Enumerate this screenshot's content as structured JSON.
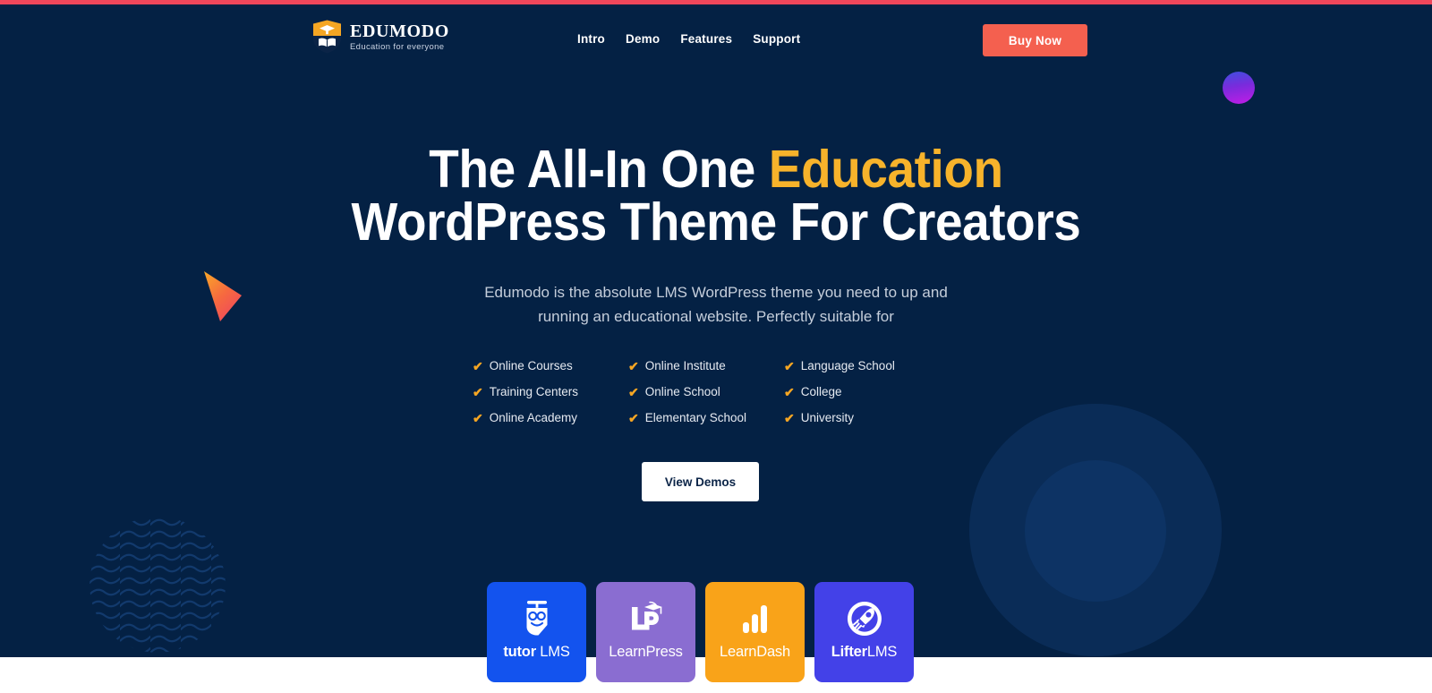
{
  "theme": {
    "bg_navy": "#042144",
    "accent_yellow": "#f7b32b",
    "accent_coral": "#f4604f",
    "accent_red_bar": "#f0475b",
    "check_orange": "#f5a623"
  },
  "header": {
    "logo": {
      "icon": "graduation-cap-shield-icon",
      "word": "EDUMODO",
      "tagline": "Education for everyone"
    },
    "nav": [
      {
        "label": "Intro"
      },
      {
        "label": "Demo"
      },
      {
        "label": "Features"
      },
      {
        "label": "Support"
      }
    ],
    "cta": {
      "label": "Buy Now"
    }
  },
  "hero": {
    "title_line1_a": "The All-In One ",
    "title_line1_accent": "Education",
    "title_line2": "WordPress Theme For Creators",
    "subtitle_line1": "Edumodo is the absolute LMS WordPress theme you need to up and",
    "subtitle_line2": "running an educational website. Perfectly suitable for",
    "features": [
      {
        "label": "Online Courses"
      },
      {
        "label": "Online Institute"
      },
      {
        "label": "Language School"
      },
      {
        "label": "Training Centers"
      },
      {
        "label": "Online School"
      },
      {
        "label": "College"
      },
      {
        "label": "Online Academy"
      },
      {
        "label": "Elementary School"
      },
      {
        "label": "University"
      }
    ],
    "demos_button": {
      "label": "View Demos"
    }
  },
  "plugins": [
    {
      "name_bold": "tutor",
      "name_regular": " LMS",
      "icon": "tutor-lms-owl-icon",
      "color": "#1353ee"
    },
    {
      "name_bold": "",
      "name_regular": "LearnPress",
      "icon": "learnpress-lp-cap-icon",
      "color": "#8a6dd1"
    },
    {
      "name_bold": "",
      "name_regular": "LearnDash",
      "icon": "learndash-bars-icon",
      "color": "#f9a319"
    },
    {
      "name_bold": "Lifter",
      "name_regular": "LMS",
      "icon": "lifterlms-rocket-icon",
      "color": "#4341e8"
    }
  ],
  "decorations": {
    "gradient_dot": "purple-gradient-circle",
    "triangle": "orange-gradient-play-triangle",
    "wave_circle": "wavy-lines-circle",
    "big_circles": "concentric-circles"
  }
}
